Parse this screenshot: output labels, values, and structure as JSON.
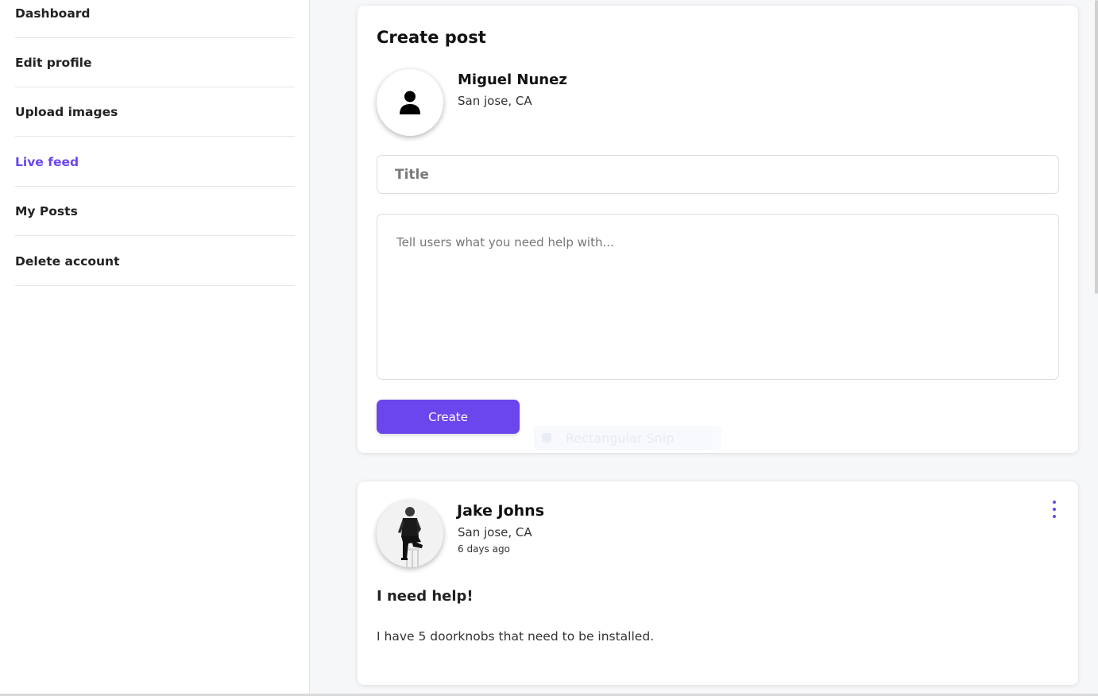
{
  "sidebar": {
    "items": [
      {
        "label": "Dashboard",
        "active": false
      },
      {
        "label": "Edit profile",
        "active": false
      },
      {
        "label": "Upload images",
        "active": false
      },
      {
        "label": "Live feed",
        "active": true
      },
      {
        "label": "My Posts",
        "active": false
      },
      {
        "label": "Delete account",
        "active": false
      }
    ]
  },
  "create_post": {
    "heading": "Create post",
    "author": {
      "name": "Miguel Nunez",
      "location": "San jose, CA",
      "avatar_icon": "user-silhouette-icon"
    },
    "title_placeholder": "Title",
    "description_placeholder": "Tell users what you need help with...",
    "create_button_label": "Create"
  },
  "overlay": {
    "snip_label": "Rectangular Snip"
  },
  "feed": {
    "posts": [
      {
        "author": {
          "name": "Jake Johns",
          "location": "San jose, CA",
          "avatar_icon": "profile-photo"
        },
        "time_ago": "6 days ago",
        "title": "I need help!",
        "body": "I have 5 doorknobs that need to be installed.",
        "menu_icon": "vertical-dots-icon"
      }
    ]
  },
  "colors": {
    "accent": "#6b46ec",
    "background": "#f6f7f9",
    "card": "#ffffff"
  }
}
